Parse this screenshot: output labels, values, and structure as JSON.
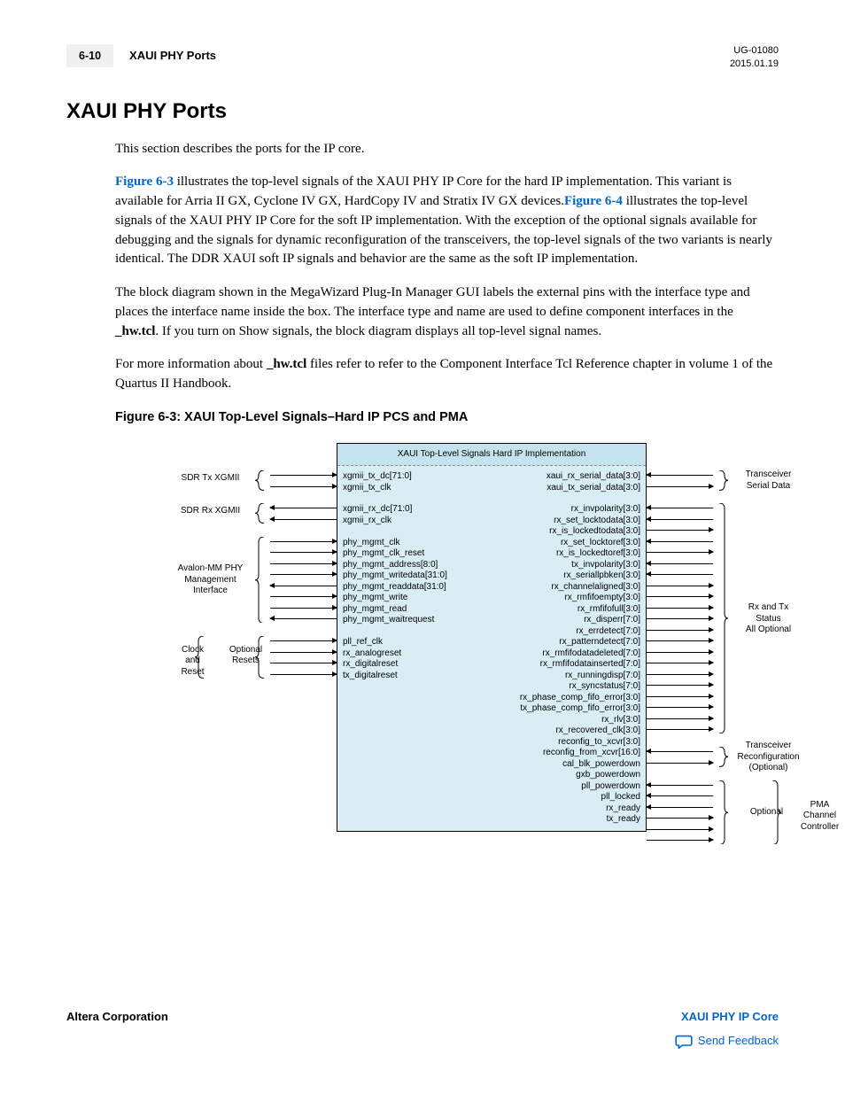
{
  "header": {
    "page_num": "6-10",
    "section": "XAUI PHY Ports",
    "doc_id": "UG-01080",
    "date": "2015.01.19"
  },
  "title": "XAUI PHY Ports",
  "para1_a": "This section describes the ports for the IP core.",
  "para2_link1": "Figure 6-3",
  "para2_a": " illustrates the top-level signals of the XAUI PHY IP Core for the hard IP implementation. This variant is available for Arria II GX, Cyclone IV GX, HardCopy IV and Stratix IV GX devices.",
  "para2_link2": "Figure 6-4",
  "para2_b": " illustrates the top-level signals of the XAUI PHY IP Core for the soft IP implementation. With the exception of the optional signals available for debugging and the signals for dynamic reconfiguration of the transceivers, the top-level signals of the two variants is nearly identical. The DDR XAUI soft IP signals and behavior are the same as the soft IP implementation.",
  "para3_a": "The block diagram shown in the MegaWizard Plug-In Manager GUI labels the external pins with the interface type and places the interface name inside the box. The interface type and name are used to define component interfaces in the ",
  "para3_bold1": "_hw.tcl",
  "para3_b": ". If you turn on Show signals, the block diagram displays all top-level signal names.",
  "para4_a": "For more information about ",
  "para4_bold1": "_hw.tcl",
  "para4_b": " files refer to refer to the Component Interface Tcl Reference chapter in volume 1 of the Quartus II Handbook.",
  "fig_caption": "Figure 6-3: XAUI Top-Level Signals–Hard IP PCS and PMA",
  "diagram": {
    "box_title": "XAUI Top-Level Signals Hard IP Implementation",
    "left_groups": {
      "sdr_tx": {
        "label": "SDR Tx XGMII",
        "signals": [
          "xgmii_tx_dc[71:0]",
          "xgmii_tx_clk"
        ]
      },
      "sdr_rx": {
        "label": "SDR Rx XGMII",
        "signals": [
          "xgmii_rx_dc[71:0]",
          "xgmii_rx_clk"
        ]
      },
      "mgmt": {
        "label": "Avalon-MM PHY\nManagement\nInterface",
        "signals": [
          "phy_mgmt_clk",
          "phy_mgmt_clk_reset",
          "phy_mgmt_address[8:0]",
          "phy_mgmt_writedata[31:0]",
          "phy_mgmt_readdata[31:0]",
          "phy_mgmt_write",
          "phy_mgmt_read",
          "phy_mgmt_waitrequest"
        ]
      },
      "clk": {
        "label1": "Clock\nand\nReset",
        "label2": "Optional\nResets",
        "signals": [
          "pll_ref_clk",
          "rx_analogreset",
          "rx_digitalreset",
          "tx_digitalreset"
        ]
      }
    },
    "right_groups": {
      "serial": {
        "label": "Transceiver\nSerial Data",
        "signals": [
          "xaui_rx_serial_data[3:0]",
          "xaui_tx_serial_data[3:0]"
        ]
      },
      "status": {
        "label": "Rx and Tx\nStatus\nAll Optional",
        "signals": [
          "rx_invpolarity[3:0]",
          "rx_set_locktodata[3:0]",
          "rx_is_lockedtodata[3:0]",
          "rx_set_locktoref[3:0]",
          "rx_is_lockedtoref[3:0]",
          "tx_invpolarity[3:0]",
          "rx_seriallpbken[3:0]",
          "rx_channelaligned[3:0]",
          "rx_rmfifoempty[3:0]",
          "rx_rmfifofull[3:0]",
          "rx_disperr[7:0]",
          "rx_errdetect[7:0]",
          "rx_patterndetect[7:0]",
          "rx_rmfifodatadeleted[7:0]",
          "rx_rmfifodatainserted[7:0]",
          "rx_runningdisp[7:0]",
          "rx_syncstatus[7:0]",
          "rx_phase_comp_fifo_error[3:0]",
          "tx_phase_comp_fifo_error[3:0]",
          "rx_rlv[3:0]",
          "rx_recovered_clk[3:0]"
        ]
      },
      "reconfig": {
        "label": "Transceiver\nReconfiguration\n(Optional)",
        "signals": [
          "reconfig_to_xcvr[3:0]",
          "reconfig_from_xcvr[16:0]"
        ]
      },
      "pma": {
        "label1": "Optional",
        "label2": "PMA\nChannel\nController",
        "signals": [
          "cal_blk_powerdown",
          "gxb_powerdown",
          "pll_powerdown",
          "pll_locked",
          "rx_ready",
          "tx_ready"
        ]
      }
    }
  },
  "footer": {
    "left": "Altera Corporation",
    "right_link": "XAUI PHY IP Core",
    "feedback": "Send Feedback"
  }
}
